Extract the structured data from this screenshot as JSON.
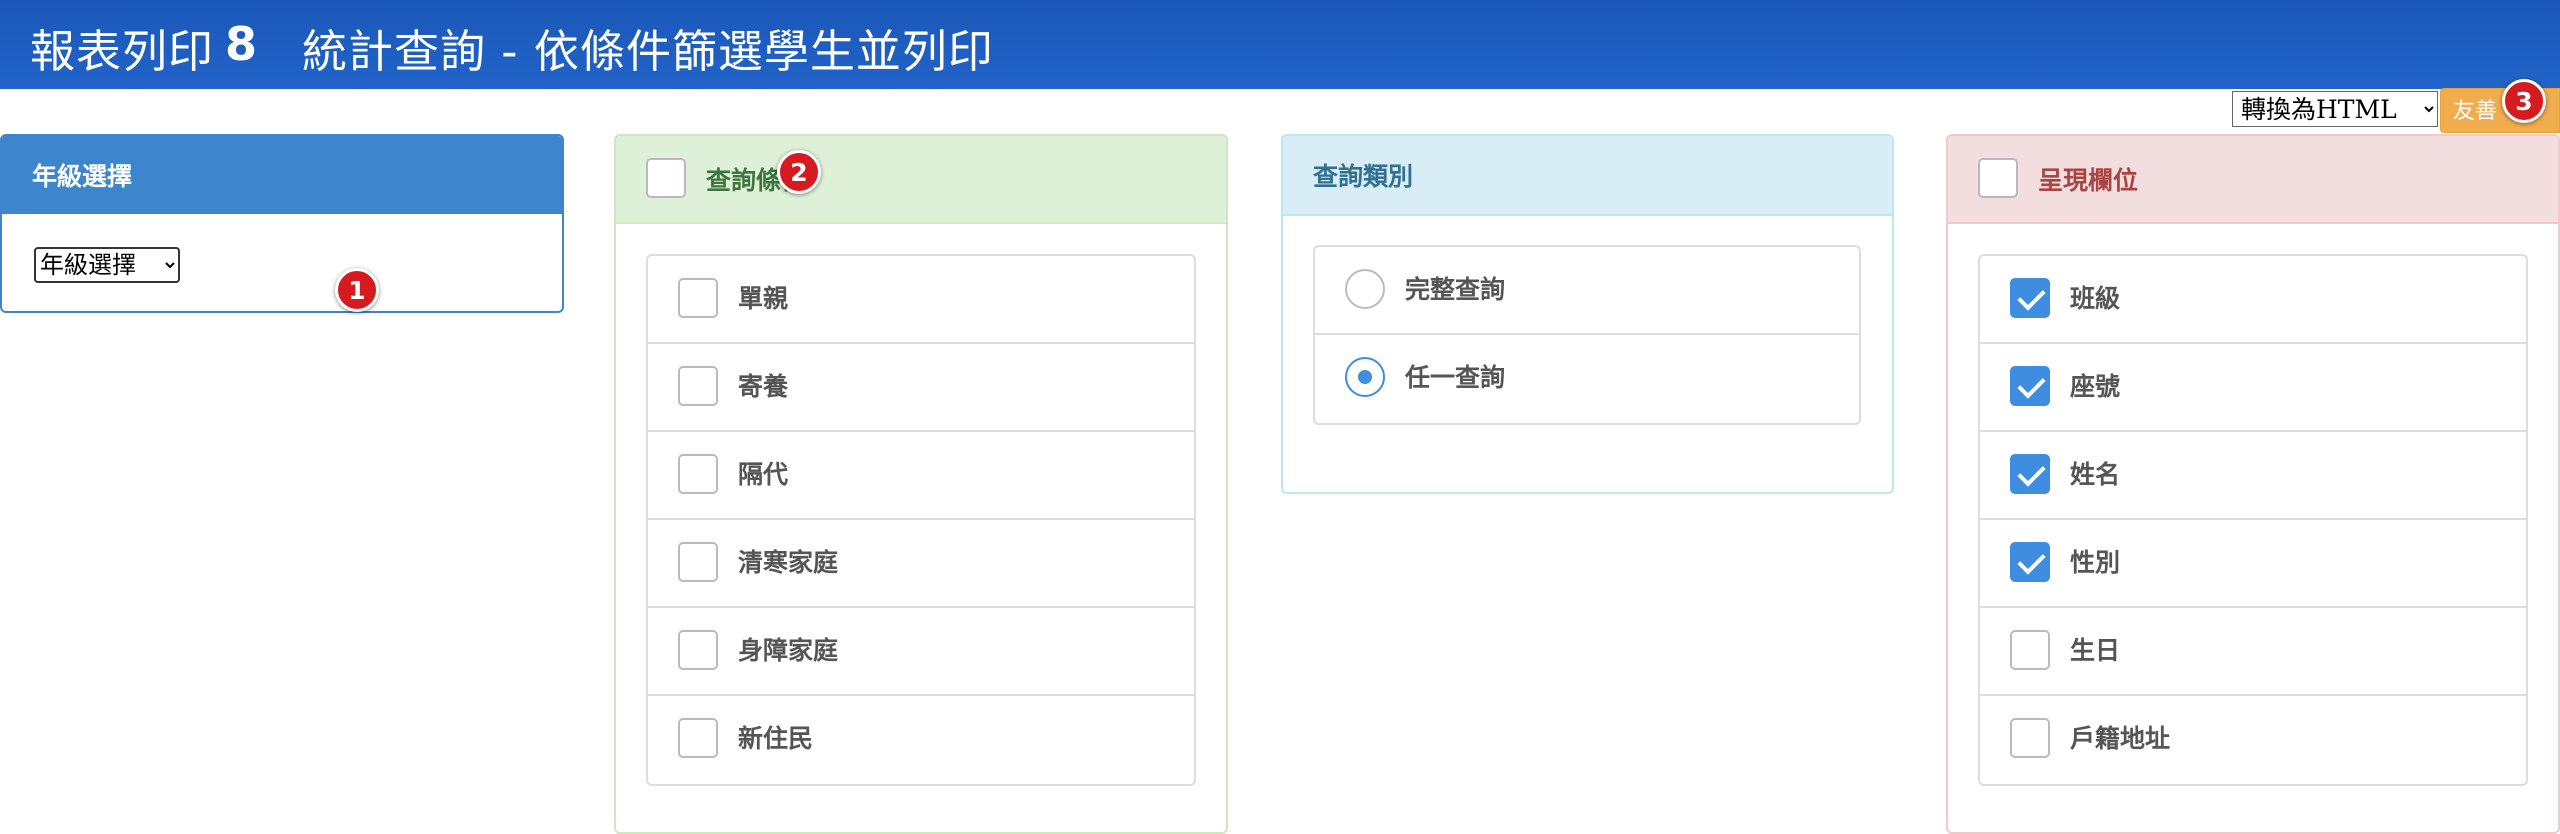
{
  "header": {
    "title_main": "報表列印",
    "title_num": "8",
    "title_sub": "統計查詢 - 依條件篩選學生並列印"
  },
  "tools": {
    "format_selected": "轉換為HTML",
    "print_label": "友善"
  },
  "badges": {
    "b1": "1",
    "b2": "2",
    "b3": "3"
  },
  "grade_panel": {
    "heading": "年級選擇",
    "select_value": "年級選擇"
  },
  "condition_panel": {
    "heading": "查詢條件",
    "items": [
      {
        "label": "單親",
        "checked": false
      },
      {
        "label": "寄養",
        "checked": false
      },
      {
        "label": "隔代",
        "checked": false
      },
      {
        "label": "清寒家庭",
        "checked": false
      },
      {
        "label": "身障家庭",
        "checked": false
      },
      {
        "label": "新住民",
        "checked": false
      }
    ]
  },
  "type_panel": {
    "heading": "查詢類別",
    "options": [
      {
        "label": "完整查詢",
        "selected": false
      },
      {
        "label": "任一查詢",
        "selected": true
      }
    ]
  },
  "columns_panel": {
    "heading": "呈現欄位",
    "items": [
      {
        "label": "班級",
        "checked": true
      },
      {
        "label": "座號",
        "checked": true
      },
      {
        "label": "姓名",
        "checked": true
      },
      {
        "label": "性別",
        "checked": true
      },
      {
        "label": "生日",
        "checked": false
      },
      {
        "label": "戶籍地址",
        "checked": false
      }
    ]
  },
  "colors": {
    "header_blue": "#1b58b8",
    "accent_blue": "#3f8de0",
    "badge_red": "#d61a1f",
    "print_orange": "#f0ad4e"
  }
}
